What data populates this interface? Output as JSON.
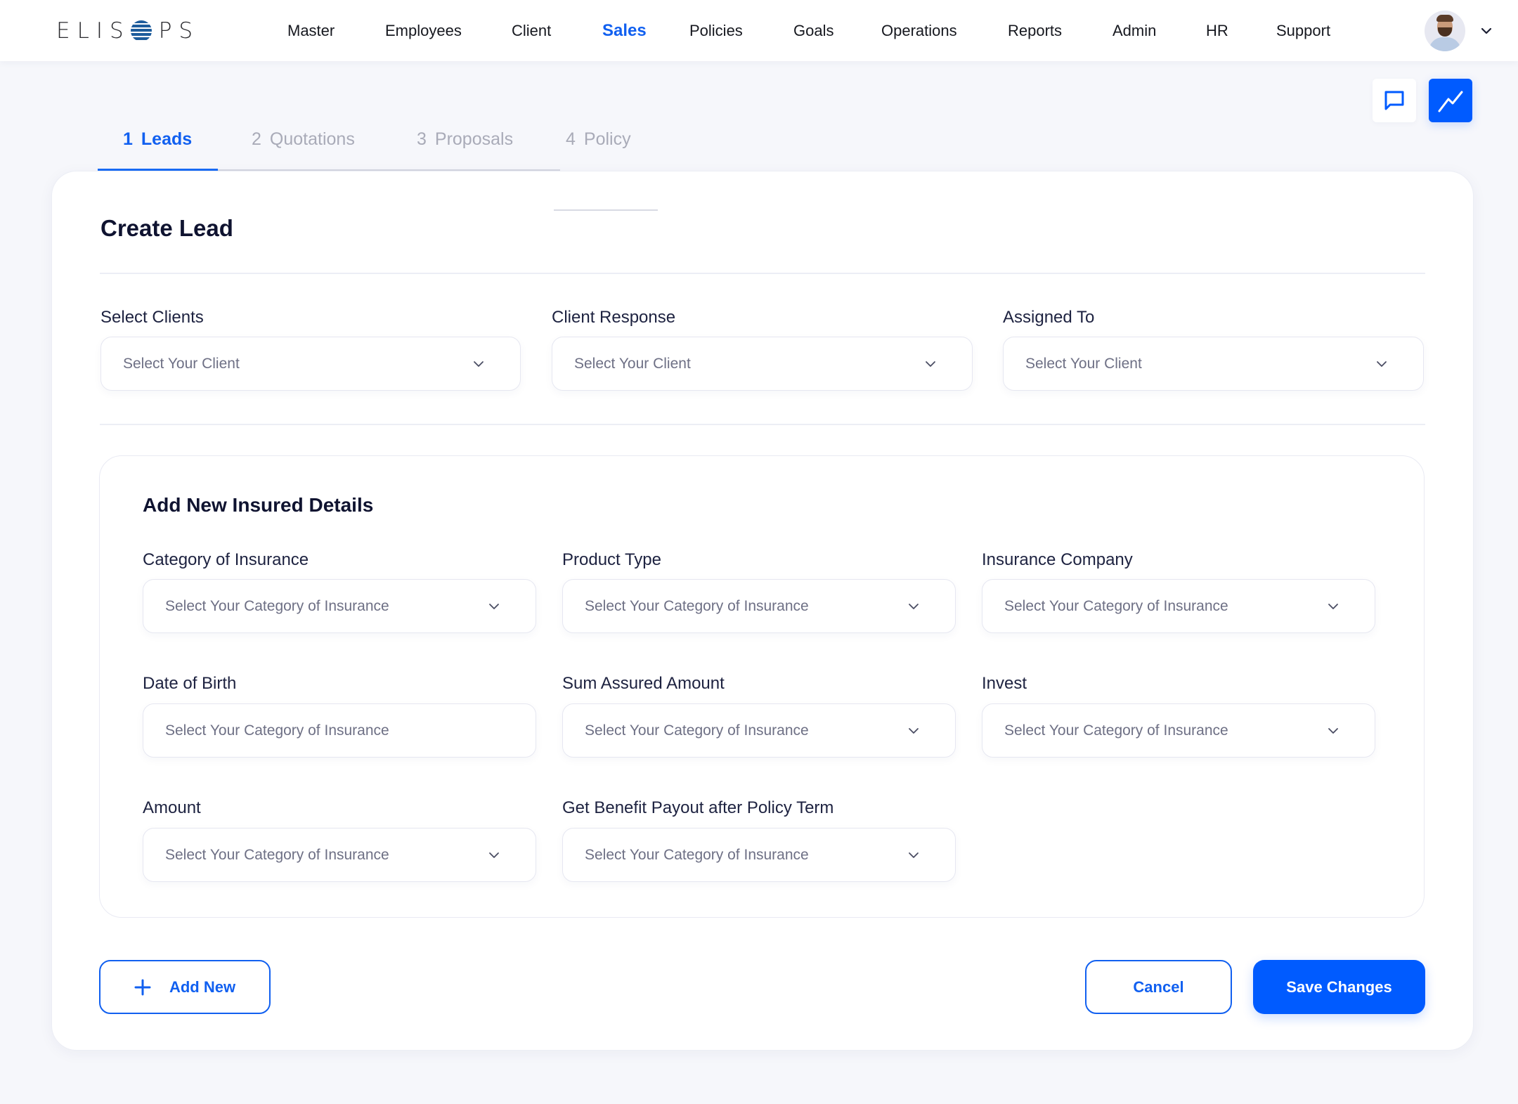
{
  "header": {
    "logo_left": "ELIS",
    "logo_right": "PS",
    "nav": [
      {
        "label": "Master",
        "active": false
      },
      {
        "label": "Employees",
        "active": false
      },
      {
        "label": "Client",
        "active": false
      },
      {
        "label": "Sales",
        "active": true
      },
      {
        "label": "Policies",
        "active": false
      },
      {
        "label": "Goals",
        "active": false
      },
      {
        "label": "Operations",
        "active": false
      },
      {
        "label": "Reports",
        "active": false
      },
      {
        "label": "Admin",
        "active": false
      },
      {
        "label": "HR",
        "active": false
      },
      {
        "label": "Support",
        "active": false
      }
    ],
    "avatar_icon": "user-avatar",
    "menu_icon": "chevron-down-icon"
  },
  "actions": {
    "chat_icon": "chat-bubble-icon",
    "trend_icon": "trend-chart-icon"
  },
  "steps": [
    {
      "num": "1",
      "label": "Leads",
      "active": true
    },
    {
      "num": "2",
      "label": "Quotations",
      "active": false
    },
    {
      "num": "3",
      "label": "Proposals",
      "active": false
    },
    {
      "num": "4",
      "label": "Policy",
      "active": false
    }
  ],
  "form": {
    "title": "Create Lead",
    "top_fields": [
      {
        "label": "Select Clients",
        "placeholder": "Select Your Client"
      },
      {
        "label": "Client Response",
        "placeholder": "Select Your Client"
      },
      {
        "label": "Assigned To",
        "placeholder": "Select Your Client"
      }
    ],
    "insured": {
      "title": "Add New Insured Details",
      "fields": [
        {
          "label": "Category of Insurance",
          "placeholder": "Select Your Category of Insurance",
          "dropdown": true
        },
        {
          "label": "Product Type",
          "placeholder": "Select Your Category of Insurance",
          "dropdown": true
        },
        {
          "label": "Insurance Company",
          "placeholder": "Select Your Category of Insurance",
          "dropdown": true
        },
        {
          "label": "Date of Birth",
          "placeholder": "Select Your Category of Insurance",
          "dropdown": false
        },
        {
          "label": "Sum Assured Amount",
          "placeholder": "Select Your Category of Insurance",
          "dropdown": true
        },
        {
          "label": "Invest",
          "placeholder": "Select Your Category of Insurance",
          "dropdown": true
        },
        {
          "label": "Amount",
          "placeholder": "Select Your Category of Insurance",
          "dropdown": true
        },
        {
          "label": "Get Benefit Payout after Policy Term",
          "placeholder": "Select Your Category of Insurance",
          "dropdown": true
        }
      ]
    },
    "buttons": {
      "add_new": "Add New",
      "cancel": "Cancel",
      "save": "Save Changes"
    }
  },
  "colors": {
    "accent": "#005bff",
    "active_text": "#1160f0",
    "muted_tab": "#a9abb8",
    "background": "#f6f7fb"
  }
}
